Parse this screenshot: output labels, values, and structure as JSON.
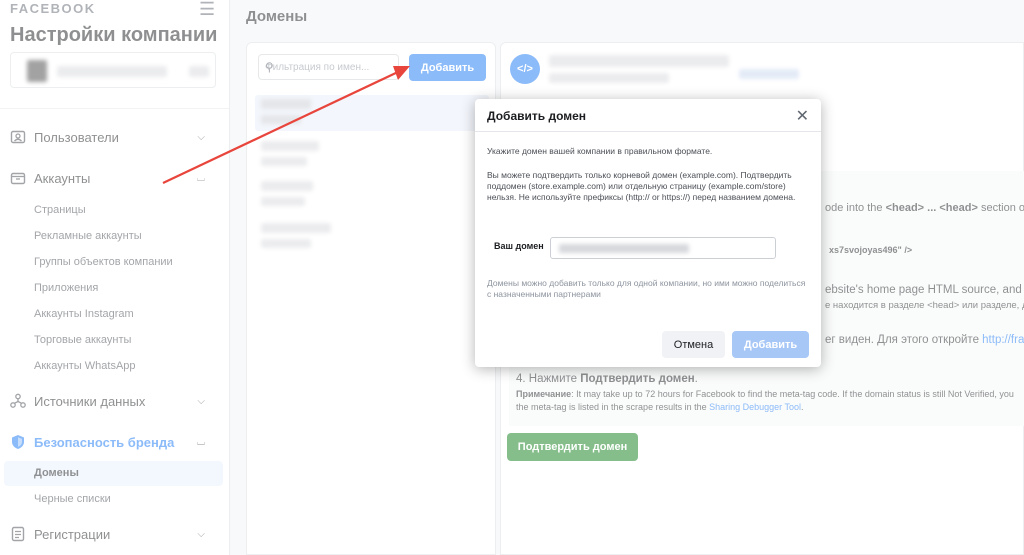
{
  "sidebar": {
    "brand": "FACEBOOK",
    "title": "Настройки компании",
    "nav": {
      "users": "Пользователи",
      "accounts": "Аккаунты",
      "data_sources": "Источники данных",
      "brand_safety": "Безопасность бренда",
      "registrations": "Регистрации"
    },
    "accounts_sub": [
      "Страницы",
      "Рекламные аккаунты",
      "Группы объектов компании",
      "Приложения",
      "Аккаунты Instagram",
      "Торговые аккаунты",
      "Аккаунты WhatsApp"
    ],
    "brand_safety_sub": [
      "Домены",
      "Черные списки"
    ]
  },
  "main": {
    "title": "Домены",
    "filter_placeholder": "Фильтрация по имен...",
    "add_button": "Добавить"
  },
  "detail": {
    "icon_label": "</>",
    "line_head_pre": "ode into the ",
    "line_head_tag1": "<head>",
    "line_head_mid": " ... ",
    "line_head_tag2": "<head>",
    "line_head_post": " section of y",
    "meta_tail": "xs7svojoyas496\" />",
    "line_html": "ebsite's home page HTML source, and pub",
    "line_head_ru": "е находится в разделе <head> или разделе, дин",
    "line_visible_pre": "ег виден. Для этого откройте ",
    "line_visible_link": "http://franks",
    "step4_pre": "4. Нажмите ",
    "step4_bold": "Подтвердить домен",
    "step4_post": ".",
    "note_label": "Примечание",
    "note_text": ": It may take up to 72 hours for Facebook to find the meta-tag code. If the domain status is still Not Verified, you",
    "note_line2_pre": "the meta-tag is listed in the scrape results in the ",
    "note_line2_link": "Sharing Debugger Tool",
    "note_line2_post": ".",
    "verify_button": "Подтвердить домен"
  },
  "modal": {
    "title": "Добавить домен",
    "para1": "Укажите домен вашей компании в правильном формате.",
    "para2": "Вы можете подтвердить только корневой домен (example.com). Подтвердить поддомен (store.example.com) или отдельную страницу (example.com/store) нельзя. Не используйте префиксы (http:// or https://) перед названием домена.",
    "field_label": "Ваш домен",
    "note": "Домены можно добавить только для одной компании, но ими можно поделиться с назначенными партнерами",
    "cancel": "Отмена",
    "submit": "Добавить"
  },
  "colors": {
    "accent": "#1877f2",
    "verify_green": "#0a7d16",
    "annotation_arrow": "#e8453c"
  }
}
